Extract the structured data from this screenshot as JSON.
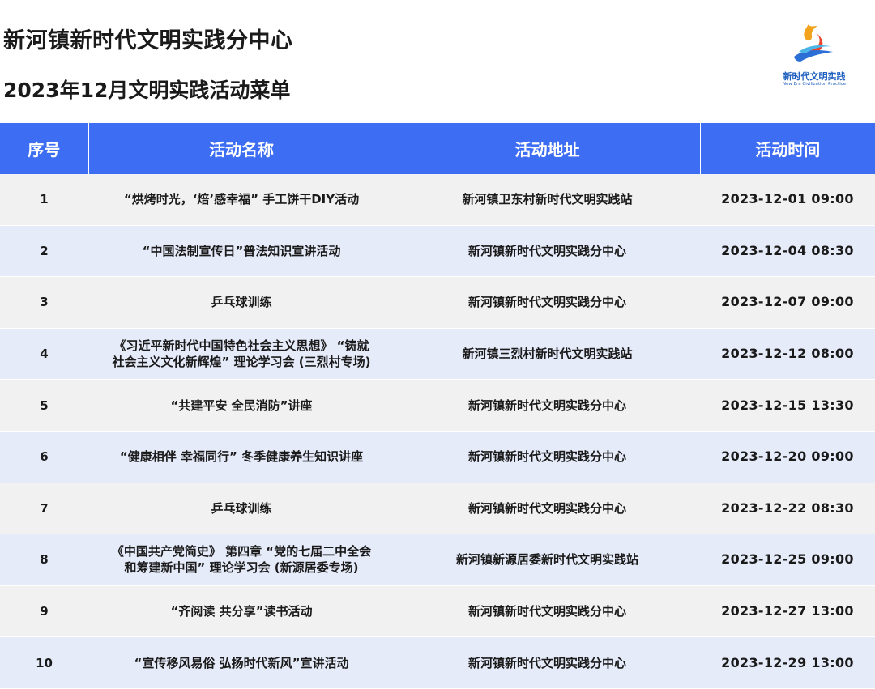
{
  "header": {
    "title": "新河镇新时代文明实践分中心",
    "subtitle": "2023年12月文明实践活动菜单"
  },
  "logo": {
    "cn_text": "新时代文明实践",
    "en_text": "New Era Civilization Practice",
    "colors": [
      "#f2a21b",
      "#e8452c",
      "#2b6fd6",
      "#4bb5e8"
    ]
  },
  "table": {
    "header_color": "#3d6df2",
    "columns": [
      "序号",
      "活动名称",
      "活动地址",
      "活动时间"
    ],
    "rows": [
      {
        "no": "1",
        "name": "“烘烤时光，‘焙’感幸福” 手工饼干DIY活动",
        "name2": "",
        "address": "新河镇卫东村新时代文明实践站",
        "time": "2023-12-01 09:00"
      },
      {
        "no": "2",
        "name": "“中国法制宣传日”普法知识宣讲活动",
        "name2": "",
        "address": "新河镇新时代文明实践分中心",
        "time": "2023-12-04 08:30"
      },
      {
        "no": "3",
        "name": "乒乓球训练",
        "name2": "",
        "address": "新河镇新时代文明实践分中心",
        "time": "2023-12-07 09:00"
      },
      {
        "no": "4",
        "name": "《习近平新时代中国特色社会主义思想》 “铸就",
        "name2": "社会主义文化新辉煌” 理论学习会 (三烈村专场)",
        "address": "新河镇三烈村新时代文明实践站",
        "time": "2023-12-12 08:00"
      },
      {
        "no": "5",
        "name": "“共建平安 全民消防”讲座",
        "name2": "",
        "address": "新河镇新时代文明实践分中心",
        "time": "2023-12-15 13:30"
      },
      {
        "no": "6",
        "name": "“健康相伴 幸福同行” 冬季健康养生知识讲座",
        "name2": "",
        "address": "新河镇新时代文明实践分中心",
        "time": "2023-12-20 09:00"
      },
      {
        "no": "7",
        "name": "乒乓球训练",
        "name2": "",
        "address": "新河镇新时代文明实践分中心",
        "time": "2023-12-22 08:30"
      },
      {
        "no": "8",
        "name": "《中国共产党简史》 第四章 “党的七届二中全会",
        "name2": "和筹建新中国” 理论学习会 (新源居委专场)",
        "address": "新河镇新源居委新时代文明实践站",
        "time": "2023-12-25 09:00"
      },
      {
        "no": "9",
        "name": "“齐阅读 共分享”读书活动",
        "name2": "",
        "address": "新河镇新时代文明实践分中心",
        "time": "2023-12-27 13:00"
      },
      {
        "no": "10",
        "name": "“宣传移风易俗 弘扬时代新风”宣讲活动",
        "name2": "",
        "address": "新河镇新时代文明实践分中心",
        "time": "2023-12-29 13:00"
      }
    ]
  }
}
